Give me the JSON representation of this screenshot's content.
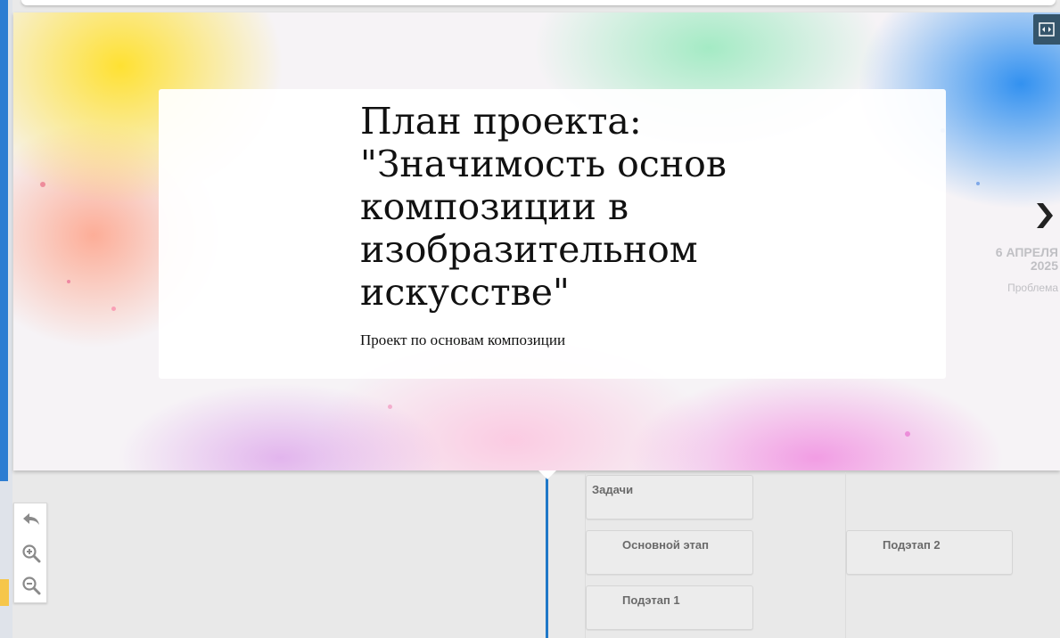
{
  "slide": {
    "title": "План проекта: \"Значимость основ композиции в изобразительном искусстве\"",
    "subtitle": "Проект по основам композиции",
    "next_event": {
      "date": "6 АПРЕЛЯ\n2025",
      "description": "Проблема"
    }
  },
  "icons": {
    "fullscreen": "fullscreen-icon",
    "next": "chevron-right-icon",
    "back": "back-arrow-icon",
    "zoom_in": "zoom-in-icon",
    "zoom_out": "zoom-out-icon"
  },
  "timeline": {
    "events": [
      {
        "label": "Задачи"
      },
      {
        "label": "Основной этап"
      },
      {
        "label": "Подэтап 2"
      },
      {
        "label": "Подэтап 1"
      }
    ]
  },
  "colors": {
    "timeline_line": "#1f78c8",
    "fullscreen_button": "#35556b"
  }
}
